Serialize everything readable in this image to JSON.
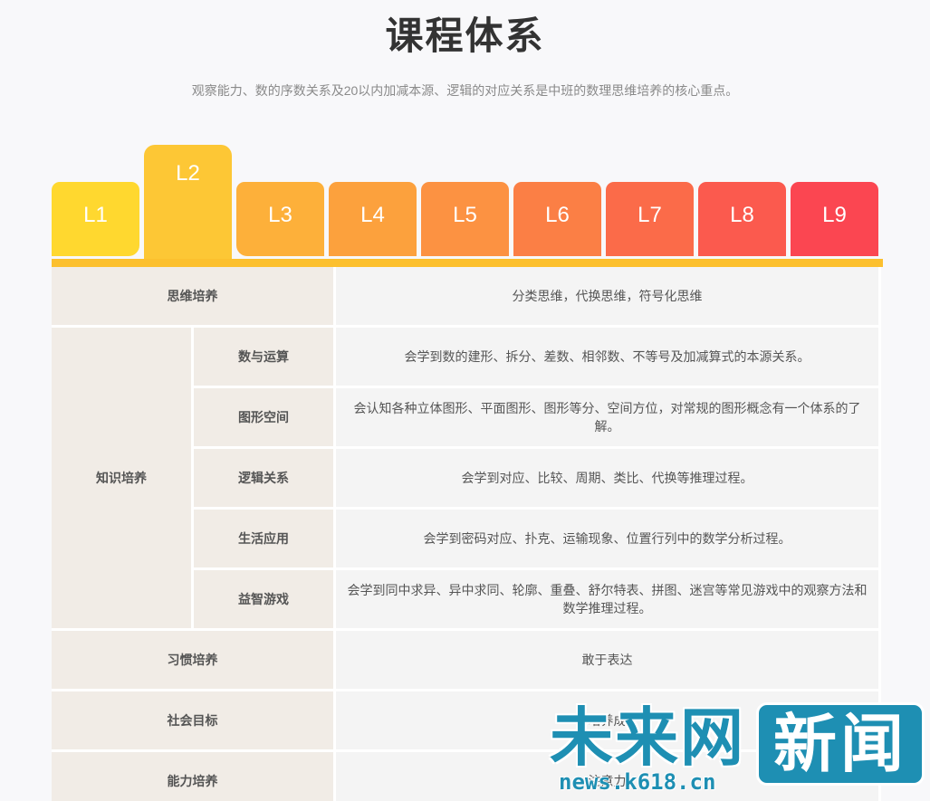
{
  "header": {
    "title": "课程体系",
    "subtitle": "观察能力、数的序数关系及20以内加减本源、逻辑的对应关系是中班的数理思维培养的核心重点。"
  },
  "tabs": [
    {
      "label": "L1",
      "color": "#ffd82f",
      "active": false
    },
    {
      "label": "L2",
      "color": "#fdc735",
      "active": true
    },
    {
      "label": "L3",
      "color": "#fdb03a",
      "active": false
    },
    {
      "label": "L4",
      "color": "#fca13d",
      "active": false
    },
    {
      "label": "L5",
      "color": "#fc9242",
      "active": false
    },
    {
      "label": "L6",
      "color": "#fb7f45",
      "active": false
    },
    {
      "label": "L7",
      "color": "#fb6b49",
      "active": false
    },
    {
      "label": "L8",
      "color": "#fb5a4e",
      "active": false
    },
    {
      "label": "L9",
      "color": "#fb4651",
      "active": false
    }
  ],
  "table": {
    "thinking": {
      "label": "思维培养",
      "content": "分类思维，代换思维，符号化思维"
    },
    "knowledge": {
      "label": "知识培养",
      "rows": [
        {
          "label": "数与运算",
          "content": "会学到数的建形、拆分、差数、相邻数、不等号及加减算式的本源关系。"
        },
        {
          "label": "图形空间",
          "content": "会认知各种立体图形、平面图形、图形等分、空间方位，对常规的图形概念有一个体系的了解。"
        },
        {
          "label": "逻辑关系",
          "content": "会学到对应、比较、周期、类比、代换等推理过程。"
        },
        {
          "label": "生活应用",
          "content": "会学到密码对应、扑克、运输现象、位置行列中的数学分析过程。"
        },
        {
          "label": "益智游戏",
          "content": "会学到同中求异、异中求同、轮廓、重叠、舒尔特表、拼图、迷宫等常见游戏中的观察方法和数学推理过程。"
        }
      ]
    },
    "habit": {
      "label": "习惯培养",
      "content": "敢于表达"
    },
    "social": {
      "label": "社会目标",
      "content": "培养成"
    },
    "ability": {
      "label": "能力培养",
      "content": "注意力"
    }
  },
  "watermark": {
    "text": "未来网",
    "box": "新闻",
    "url": "news.k618.cn"
  }
}
